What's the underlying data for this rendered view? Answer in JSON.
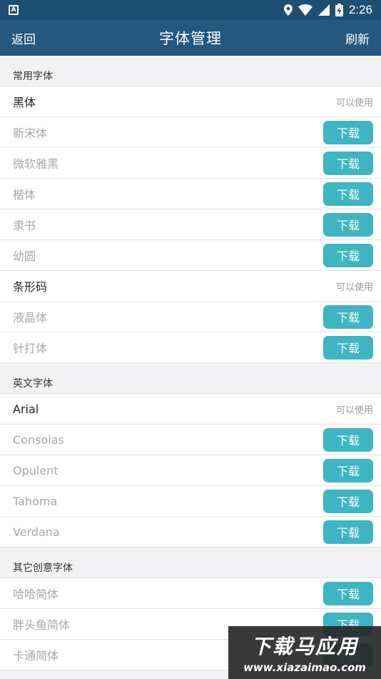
{
  "statusbar": {
    "app_icon": "android-a-icon",
    "time": "2:26",
    "icons": [
      "location-icon",
      "wifi-icon",
      "signal-icon",
      "battery-charging-icon"
    ]
  },
  "appbar": {
    "back_label": "返回",
    "title": "字体管理",
    "refresh_label": "刷新"
  },
  "sections": [
    {
      "header": "常用字体",
      "items": [
        {
          "name": "黑体",
          "installed": true,
          "status": "可以使用"
        },
        {
          "name": "新宋体",
          "installed": false,
          "action": "下载"
        },
        {
          "name": "微软雅黑",
          "installed": false,
          "action": "下载"
        },
        {
          "name": "楷体",
          "installed": false,
          "action": "下载"
        },
        {
          "name": "隶书",
          "installed": false,
          "action": "下载"
        },
        {
          "name": "幼圆",
          "installed": false,
          "action": "下载"
        },
        {
          "name": "条形码",
          "installed": true,
          "status": "可以使用"
        },
        {
          "name": "液晶体",
          "installed": false,
          "action": "下载"
        },
        {
          "name": "针打体",
          "installed": false,
          "action": "下载"
        }
      ]
    },
    {
      "header": "英文字体",
      "items": [
        {
          "name": "Arial",
          "installed": true,
          "status": "可以使用"
        },
        {
          "name": "Consolas",
          "installed": false,
          "action": "下载"
        },
        {
          "name": "Opulent",
          "installed": false,
          "action": "下载"
        },
        {
          "name": "Tahoma",
          "installed": false,
          "action": "下载"
        },
        {
          "name": "Verdana",
          "installed": false,
          "action": "下载"
        }
      ]
    },
    {
      "header": "其它创意字体",
      "items": [
        {
          "name": "哈哈简体",
          "installed": false,
          "action": "下载"
        },
        {
          "name": "胖头鱼简体",
          "installed": false,
          "action": "下载"
        },
        {
          "name": "卡通简体",
          "installed": false,
          "action": "下载"
        }
      ]
    }
  ],
  "watermark": {
    "title": "下载马应用",
    "url": "www.xiazaimao.com"
  },
  "colors": {
    "statusbar": "#1f4e73",
    "appbar": "#26577e",
    "button": "#3eb5c2",
    "background": "#f2f2f4"
  }
}
